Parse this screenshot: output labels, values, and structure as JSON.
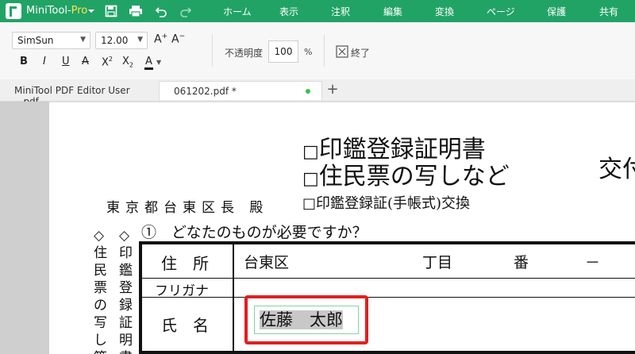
{
  "app": {
    "name_main": "MiniTool",
    "name_sep": "-",
    "name_pro": "Pro"
  },
  "menu": [
    "ホーム",
    "表示",
    "注釈",
    "編集",
    "変換",
    "ページ",
    "保護",
    "共有"
  ],
  "toolbar": {
    "font_name": "SimSun",
    "font_size": "12.00",
    "increase_font": "A",
    "decrease_font": "A",
    "bold": "B",
    "italic": "I",
    "underline": "U",
    "strike": "A",
    "superscript_base": "X",
    "superscript_mark": "2",
    "subscript_base": "X",
    "subscript_mark": "2",
    "font_color": "A",
    "opacity_label": "不透明度",
    "opacity_value": "100",
    "opacity_unit": "%",
    "finish_label": "終了"
  },
  "tabs": [
    {
      "label": "MiniTool PDF Editor User ...pdf"
    },
    {
      "label": "061202.pdf *"
    }
  ],
  "tab_add": "+",
  "document": {
    "checkbox_glyph": "□",
    "option1": "印鑑登録証明書",
    "option2": "住民票の写しなど",
    "option3": "印鑑登録証(手帳式)交換",
    "right_cut": "交付",
    "addressee": "東京都台東区長 殿",
    "question": "①　どなたのものが必要ですか？",
    "left_col1": "◇住民票の写し等",
    "left_col2": "◇印鑑登録証明書",
    "row1_label": "住　所",
    "row1_value": "台東区",
    "row1_chome": "丁目",
    "row1_ban": "番",
    "row1_dash": "－",
    "row2_label": "フリガナ",
    "row3_label": "氏　名",
    "name_value": "佐藤　太郎"
  },
  "colors": {
    "brand": "#21a366",
    "highlight": "#e02020",
    "tab_dot": "#3cc04b"
  }
}
